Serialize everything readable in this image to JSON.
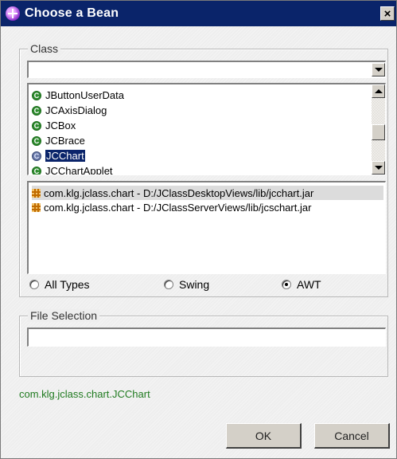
{
  "window": {
    "title": "Choose a Bean",
    "close_label": "×"
  },
  "class_group": {
    "legend": "Class",
    "search": {
      "value": "",
      "placeholder": ""
    },
    "classes": [
      {
        "name": "JButtonUserData",
        "selected": false
      },
      {
        "name": "JCAxisDialog",
        "selected": false
      },
      {
        "name": "JCBox",
        "selected": false
      },
      {
        "name": "JCBrace",
        "selected": false
      },
      {
        "name": "JCChart",
        "selected": true
      },
      {
        "name": "JCChartApplet",
        "selected": false
      }
    ],
    "class_icon_letter": "C",
    "jars": [
      {
        "text": "com.klg.jclass.chart - D:/JClassDesktopViews/lib/jcchart.jar",
        "highlighted": true
      },
      {
        "text": "com.klg.jclass.chart - D:/JClassServerViews/lib/jcschart.jar",
        "highlighted": false
      }
    ],
    "type_filter": {
      "options": [
        "All Types",
        "Swing",
        "AWT"
      ],
      "selected": "AWT"
    }
  },
  "file_group": {
    "legend": "File Selection",
    "field": {
      "value": "",
      "placeholder": ""
    }
  },
  "status": {
    "selected_class": "com.klg.jclass.chart.JCChart",
    "color": "#1f7a1f"
  },
  "buttons": {
    "ok_label": "OK",
    "cancel_label": "Cancel"
  },
  "icons": {
    "title": "bean-plus-icon",
    "class": "class-c-icon",
    "jar": "jar-package-icon",
    "dropdown": "chevron-down-icon"
  },
  "colors": {
    "titlebar": "#0a246a",
    "selection": "#0a246a",
    "class_icon": "#2e8b2e",
    "jar_icon": "#c06b00"
  }
}
